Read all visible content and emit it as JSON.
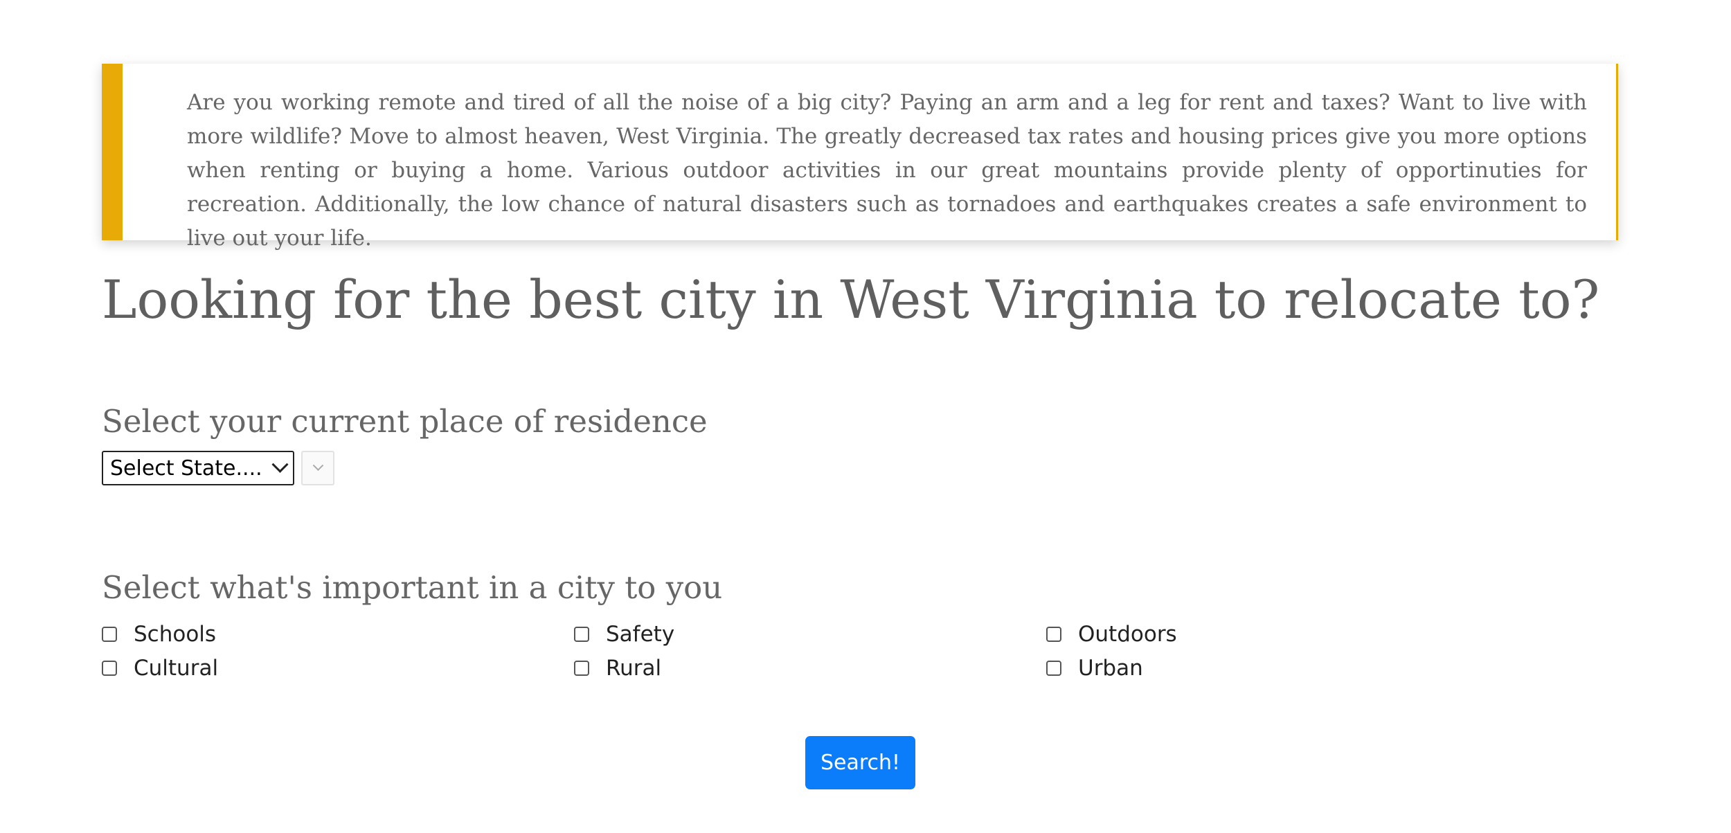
{
  "intro": {
    "text": "Are you working remote and tired of all the noise of a big city? Paying an arm and a leg for rent and taxes? Want to live with more wildlife? Move to almost heaven, West Virginia. The greatly decreased tax rates and housing prices give you more options when renting or buying a home. Various outdoor activities in our great mountains provide plenty of opportinuties for recreation. Additionally, the low chance of natural disasters such as tornadoes and earthquakes creates a safe environment to live out your life."
  },
  "page_title": "Looking for the best city in West Virginia to relocate to?",
  "residence": {
    "heading": "Select your current place of residence",
    "state_select_value": "Select State....",
    "city_select_value": ""
  },
  "important": {
    "heading": "Select what's important in a city to you",
    "options": [
      {
        "label": "Schools",
        "checked": false
      },
      {
        "label": "Safety",
        "checked": false
      },
      {
        "label": "Outdoors",
        "checked": false
      },
      {
        "label": "Cultural",
        "checked": false
      },
      {
        "label": "Rural",
        "checked": false
      },
      {
        "label": "Urban",
        "checked": false
      }
    ]
  },
  "search_button_label": "Search!",
  "colors": {
    "accent_bar": "#e8aa07",
    "button": "#0b7dfb",
    "text": "#5f5f5f"
  }
}
